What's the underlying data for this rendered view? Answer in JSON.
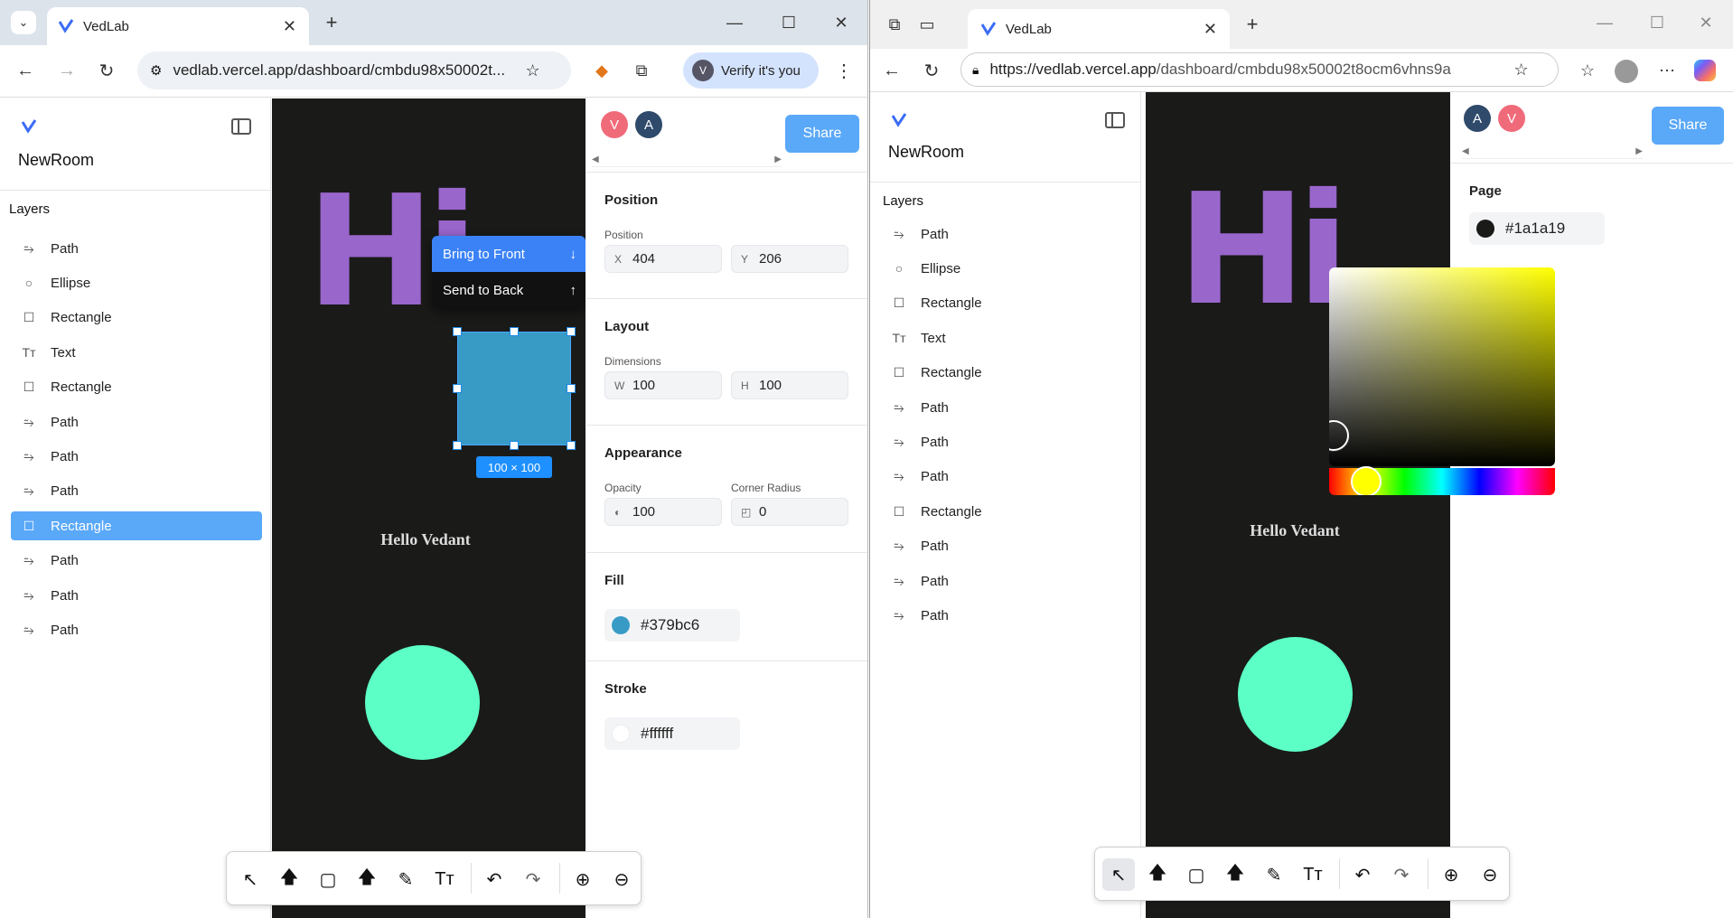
{
  "left": {
    "tab_title": "VedLab",
    "url": "vedlab.vercel.app/dashboard/cmbdu98x50002t...",
    "verify_label": "Verify it's you",
    "room_name": "NewRoom",
    "layers_title": "Layers",
    "layers": [
      {
        "label": "Path",
        "icon": "path-icon"
      },
      {
        "label": "Ellipse",
        "icon": "ellipse-icon"
      },
      {
        "label": "Rectangle",
        "icon": "rectangle-icon"
      },
      {
        "label": "Text",
        "icon": "text-icon"
      },
      {
        "label": "Rectangle",
        "icon": "rectangle-icon"
      },
      {
        "label": "Path",
        "icon": "path-icon"
      },
      {
        "label": "Path",
        "icon": "path-icon"
      },
      {
        "label": "Path",
        "icon": "path-icon"
      },
      {
        "label": "Rectangle",
        "icon": "rectangle-icon",
        "selected": true
      },
      {
        "label": "Path",
        "icon": "path-icon"
      },
      {
        "label": "Path",
        "icon": "path-icon"
      },
      {
        "label": "Path",
        "icon": "path-icon"
      }
    ],
    "avatars": [
      {
        "letter": "V",
        "color": "#f06b7a"
      },
      {
        "letter": "A",
        "color": "#2f4a6b"
      }
    ],
    "share_label": "Share",
    "context_menu": {
      "bring_front": "Bring to Front",
      "send_back": "Send to Back"
    },
    "selection_size": "100 × 100",
    "canvas_text": "Hello Vedant",
    "canvas_hi": "Hi",
    "position": {
      "title": "Position",
      "label": "Position",
      "x_prefix": "X",
      "x": "404",
      "y_prefix": "Y",
      "y": "206"
    },
    "layout": {
      "title": "Layout",
      "label": "Dimensions",
      "w_prefix": "W",
      "w": "100",
      "h_prefix": "H",
      "h": "100"
    },
    "appearance": {
      "title": "Appearance",
      "opacity_label": "Opacity",
      "opacity": "100",
      "radius_label": "Corner Radius",
      "radius": "0"
    },
    "fill": {
      "title": "Fill",
      "value": "#379bc6",
      "color": "#379bc6"
    },
    "stroke": {
      "title": "Stroke",
      "value": "#ffffff",
      "color": "#ffffff"
    }
  },
  "right": {
    "tab_title": "VedLab",
    "url_host": "https://vedlab.vercel.app",
    "url_path": "/dashboard/cmbdu98x50002t8ocm6vhns9a",
    "room_name": "NewRoom",
    "layers_title": "Layers",
    "layers": [
      {
        "label": "Path",
        "icon": "path-icon"
      },
      {
        "label": "Ellipse",
        "icon": "ellipse-icon"
      },
      {
        "label": "Rectangle",
        "icon": "rectangle-icon"
      },
      {
        "label": "Text",
        "icon": "text-icon"
      },
      {
        "label": "Rectangle",
        "icon": "rectangle-icon"
      },
      {
        "label": "Path",
        "icon": "path-icon"
      },
      {
        "label": "Path",
        "icon": "path-icon"
      },
      {
        "label": "Path",
        "icon": "path-icon"
      },
      {
        "label": "Rectangle",
        "icon": "rectangle-icon"
      },
      {
        "label": "Path",
        "icon": "path-icon"
      },
      {
        "label": "Path",
        "icon": "path-icon"
      },
      {
        "label": "Path",
        "icon": "path-icon"
      }
    ],
    "avatars": [
      {
        "letter": "A",
        "color": "#2f4a6b"
      },
      {
        "letter": "V",
        "color": "#f06b7a"
      }
    ],
    "share_label": "Share",
    "page": {
      "title": "Page",
      "value": "#1a1a19",
      "color": "#1a1a19"
    },
    "canvas_text": "Hello Vedant",
    "canvas_hi": "Hi"
  },
  "colors": {
    "accent": "#5aa8f8",
    "canvas": "#1a1a19",
    "hi_purple": "#9966cc",
    "circle": "#5cffc6",
    "rect_fill": "#379bc6"
  }
}
